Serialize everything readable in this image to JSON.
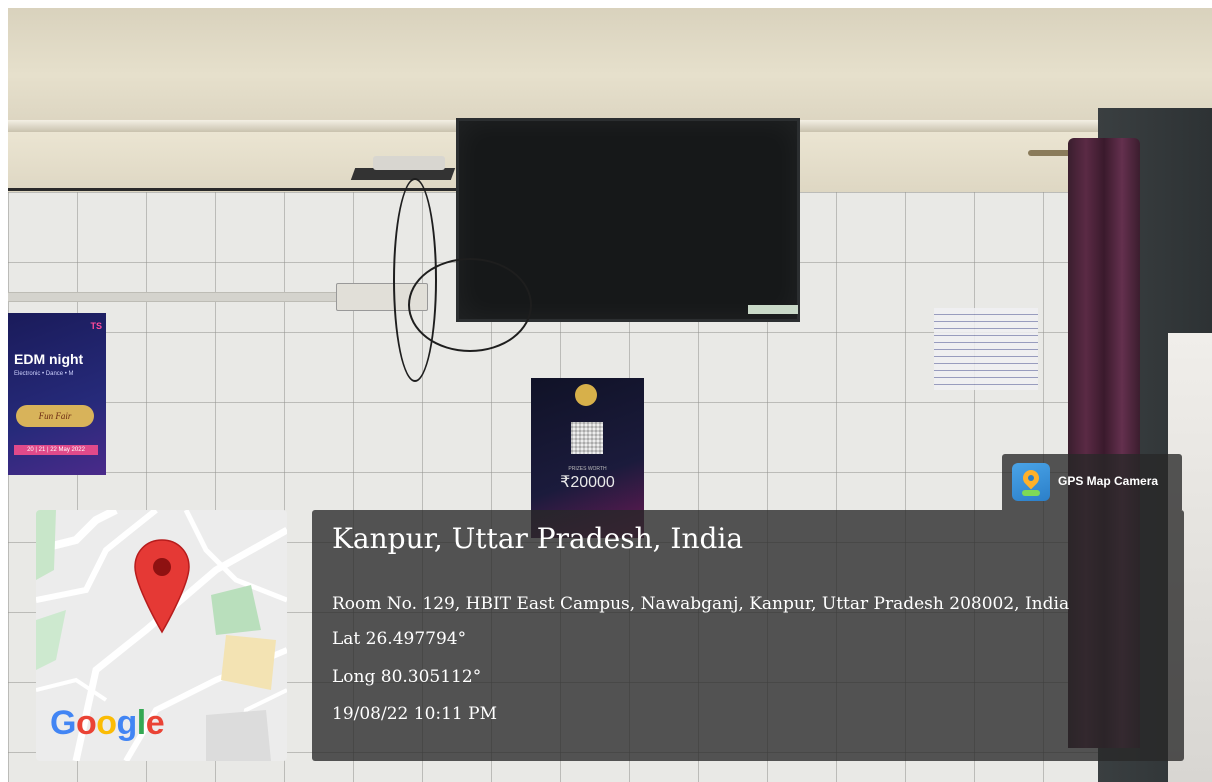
{
  "poster_left": {
    "tag": "TS",
    "title": "EDM night",
    "subtitle": "Electronic • Dance • M",
    "badge": "Fun Fair",
    "dates": "20 | 21 | 22 May 2022"
  },
  "poster_center": {
    "prize_label": "PRIZES WORTH",
    "prize": "₹20000"
  },
  "gps_badge": {
    "label": "GPS Map Camera",
    "icon": "gps-camera-app-icon"
  },
  "map": {
    "provider": "Google",
    "pin_color": "#e53935"
  },
  "location": {
    "city": "Kanpur, Uttar Pradesh, India",
    "address": "Room No. 129, HBIT East Campus, Nawabganj, Kanpur, Uttar Pradesh 208002, India",
    "lat": "Lat 26.497794°",
    "long": "Long 80.305112°",
    "datetime": "19/08/22 10:11 PM"
  }
}
